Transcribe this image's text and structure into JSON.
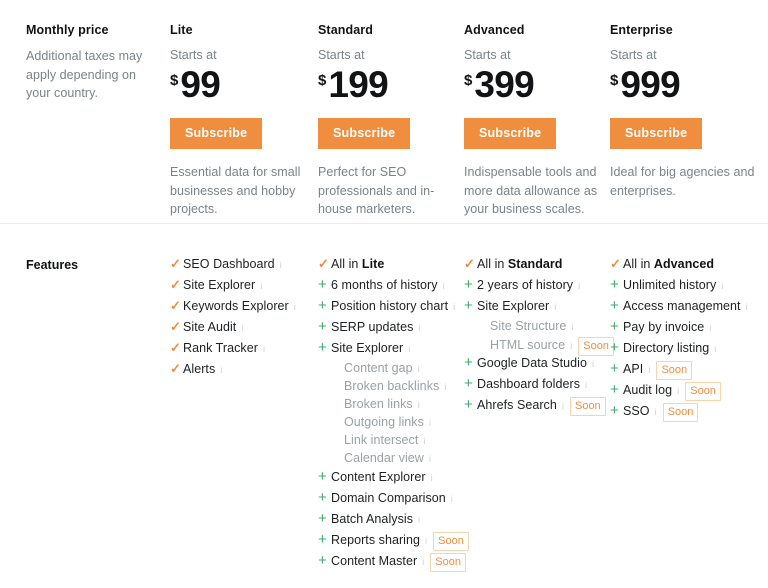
{
  "pricing": {
    "left": {
      "title": "Monthly price",
      "note": "Additional taxes may apply depending on your country."
    },
    "plans": [
      {
        "name": "Lite",
        "starts_at": "Starts at",
        "currency": "$",
        "amount": "99",
        "cta": "Subscribe",
        "blurb": "Essential data for small businesses and hobby projects."
      },
      {
        "name": "Standard",
        "starts_at": "Starts at",
        "currency": "$",
        "amount": "199",
        "cta": "Subscribe",
        "blurb": "Perfect for SEO professionals and in-house marketers."
      },
      {
        "name": "Advanced",
        "starts_at": "Starts at",
        "currency": "$",
        "amount": "399",
        "cta": "Subscribe",
        "blurb": "Indispensable tools and more data allowance as your business scales."
      },
      {
        "name": "Enterprise",
        "starts_at": "Starts at",
        "currency": "$",
        "amount": "999",
        "cta": "Subscribe",
        "blurb": "Ideal for big agencies and enterprises."
      }
    ]
  },
  "features": {
    "title": "Features",
    "icons": {
      "check": "✓",
      "plus": "+",
      "info": "i"
    },
    "colors": {
      "accent_orange": "#ef8e3f",
      "plus_green": "#3fae69",
      "text_dark": "#1d2022",
      "text_muted": "#7b8387",
      "sub_muted": "#9aa1a5",
      "soon_border": "#f6d4b0"
    },
    "columns": [
      {
        "plan": "Lite",
        "rows": [
          {
            "mark": "check",
            "text": "SEO Dashboard",
            "info": true,
            "sub": false,
            "soon": null
          },
          {
            "mark": "check",
            "text": "Site Explorer",
            "info": true,
            "sub": false,
            "soon": null
          },
          {
            "mark": "check",
            "text": "Keywords Explorer",
            "info": true,
            "sub": false,
            "soon": null
          },
          {
            "mark": "check",
            "text": "Site Audit",
            "info": true,
            "sub": false,
            "soon": null
          },
          {
            "mark": "check",
            "text": "Rank Tracker",
            "info": true,
            "sub": false,
            "soon": null
          },
          {
            "mark": "check",
            "text": "Alerts",
            "info": true,
            "sub": false,
            "soon": null
          }
        ]
      },
      {
        "plan": "Standard",
        "rows": [
          {
            "mark": "check",
            "text": "All in ",
            "strong": "Lite",
            "info": false,
            "sub": false,
            "soon": null
          },
          {
            "mark": "plus",
            "text": "6 months of history",
            "info": true,
            "sub": false,
            "soon": null
          },
          {
            "mark": "plus",
            "text": "Position history chart",
            "info": true,
            "sub": false,
            "soon": null
          },
          {
            "mark": "plus",
            "text": "SERP updates",
            "info": true,
            "sub": false,
            "soon": null
          },
          {
            "mark": "plus",
            "text": "Site Explorer",
            "info": true,
            "sub": false,
            "soon": null
          },
          {
            "mark": "none",
            "text": "Content gap",
            "info": true,
            "sub": true,
            "soon": null
          },
          {
            "mark": "none",
            "text": "Broken backlinks",
            "info": true,
            "sub": true,
            "soon": null
          },
          {
            "mark": "none",
            "text": "Broken links",
            "info": true,
            "sub": true,
            "soon": null
          },
          {
            "mark": "none",
            "text": "Outgoing links",
            "info": true,
            "sub": true,
            "soon": null
          },
          {
            "mark": "none",
            "text": "Link intersect",
            "info": true,
            "sub": true,
            "soon": null
          },
          {
            "mark": "none",
            "text": "Calendar view",
            "info": true,
            "sub": true,
            "soon": null
          },
          {
            "mark": "plus",
            "text": "Content Explorer",
            "info": true,
            "sub": false,
            "soon": null
          },
          {
            "mark": "plus",
            "text": "Domain Comparison",
            "info": true,
            "sub": false,
            "soon": null
          },
          {
            "mark": "plus",
            "text": "Batch Analysis",
            "info": true,
            "sub": false,
            "soon": null
          },
          {
            "mark": "plus",
            "text": "Reports sharing",
            "info": true,
            "sub": false,
            "soon": "Soon"
          },
          {
            "mark": "plus",
            "text": "Content Master",
            "info": true,
            "sub": false,
            "soon": "Soon"
          }
        ]
      },
      {
        "plan": "Advanced",
        "rows": [
          {
            "mark": "check",
            "text": "All in ",
            "strong": "Standard",
            "info": false,
            "sub": false,
            "soon": null
          },
          {
            "mark": "plus",
            "text": "2 years of history",
            "info": true,
            "sub": false,
            "soon": null
          },
          {
            "mark": "plus",
            "text": "Site Explorer",
            "info": true,
            "sub": false,
            "soon": null
          },
          {
            "mark": "none",
            "text": "Site Structure",
            "info": true,
            "sub": true,
            "soon": null
          },
          {
            "mark": "none",
            "text": "HTML source",
            "info": true,
            "sub": true,
            "soon": "Soon"
          },
          {
            "mark": "plus",
            "text": "Google Data Studio",
            "info": true,
            "sub": false,
            "soon": null
          },
          {
            "mark": "plus",
            "text": "Dashboard folders",
            "info": true,
            "sub": false,
            "soon": null
          },
          {
            "mark": "plus",
            "text": "Ahrefs Search",
            "info": true,
            "sub": false,
            "soon": "Soon"
          }
        ]
      },
      {
        "plan": "Enterprise",
        "rows": [
          {
            "mark": "check",
            "text": "All in ",
            "strong": "Advanced",
            "info": false,
            "sub": false,
            "soon": null
          },
          {
            "mark": "plus",
            "text": "Unlimited history",
            "info": true,
            "sub": false,
            "soon": null
          },
          {
            "mark": "plus",
            "text": "Access management",
            "info": true,
            "sub": false,
            "soon": null
          },
          {
            "mark": "plus",
            "text": "Pay by invoice",
            "info": true,
            "sub": false,
            "soon": null
          },
          {
            "mark": "plus",
            "text": "Directory listing",
            "info": true,
            "sub": false,
            "soon": null
          },
          {
            "mark": "plus",
            "text": "API",
            "info": true,
            "sub": false,
            "soon": "Soon"
          },
          {
            "mark": "plus",
            "text": "Audit log",
            "info": true,
            "sub": false,
            "soon": "Soon"
          },
          {
            "mark": "plus",
            "text": "SSO",
            "info": true,
            "sub": false,
            "soon": "Soon"
          }
        ]
      }
    ]
  }
}
